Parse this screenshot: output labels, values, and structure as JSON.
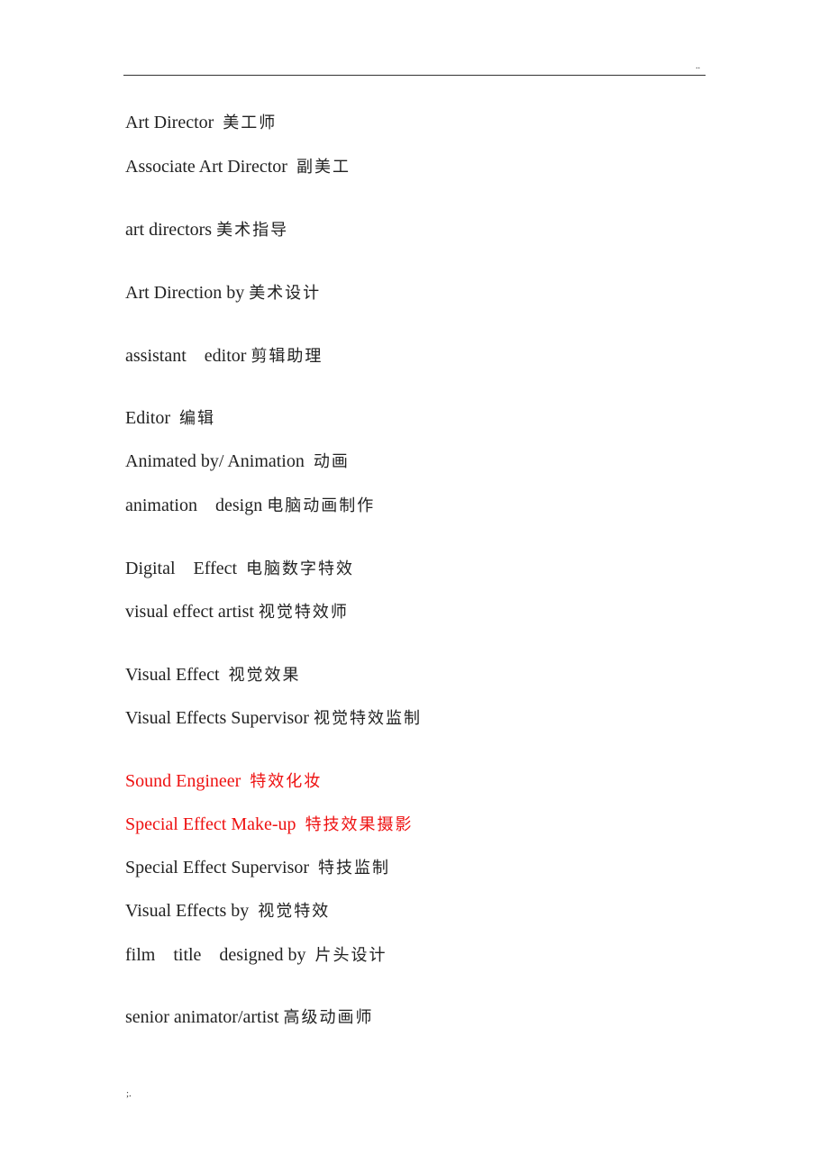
{
  "header": {
    "mark": ".."
  },
  "footer": {
    "mark": ";."
  },
  "entries": [
    {
      "en": "Art Director  ",
      "zh": "美工师",
      "color": "default"
    },
    {
      "en": "Associate Art Director  ",
      "zh": "副美工",
      "color": "default"
    },
    {
      "en": "art directors ",
      "zh": "美术指导",
      "color": "default"
    },
    {
      "en": "Art Direction by ",
      "zh": "美术设计",
      "color": "default"
    },
    {
      "en": "assistant    editor ",
      "zh": "剪辑助理",
      "color": "default"
    },
    {
      "en": "Editor  ",
      "zh": "编辑",
      "color": "default"
    },
    {
      "en": "Animated by/ Animation  ",
      "zh": "动画",
      "color": "default"
    },
    {
      "en": "animation    design ",
      "zh": "电脑动画制作",
      "color": "default"
    },
    {
      "en": "Digital    Effect  ",
      "zh": "电脑数字特效",
      "color": "default"
    },
    {
      "en": "visual effect artist ",
      "zh": "视觉特效师",
      "color": "default"
    },
    {
      "en": "Visual Effect  ",
      "zh": "视觉效果",
      "color": "default"
    },
    {
      "en": "Visual Effects Supervisor ",
      "zh": "视觉特效监制",
      "color": "default"
    },
    {
      "en": "Sound Engineer  ",
      "zh": "特效化妆",
      "color": "red"
    },
    {
      "en": "Special Effect Make-up  ",
      "zh": "特技效果摄影",
      "color": "red"
    },
    {
      "en": "Special Effect Supervisor  ",
      "zh": "特技监制",
      "color": "default"
    },
    {
      "en": "Visual Effects by  ",
      "zh": "视觉特效",
      "color": "default"
    },
    {
      "en": "film    title    designed by  ",
      "zh": "片头设计",
      "color": "default"
    },
    {
      "en": "senior animator/artist ",
      "zh": "高级动画师",
      "color": "default"
    }
  ],
  "colors": {
    "default": "#222222",
    "red": "#ee1111"
  }
}
